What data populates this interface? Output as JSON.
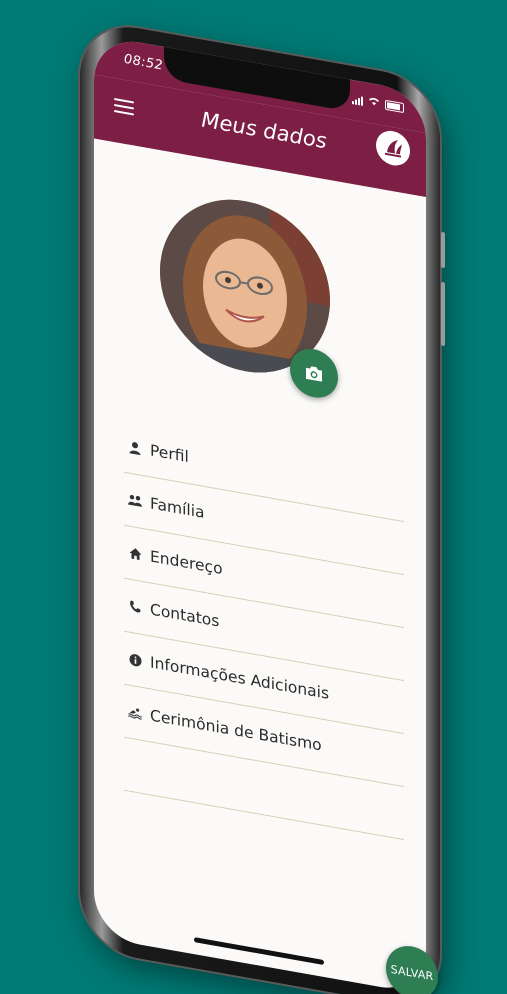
{
  "status_bar": {
    "time": "08:52"
  },
  "app_bar": {
    "title": "Meus dados",
    "menu_icon": "hamburger-menu-icon",
    "logo_icon": "church-logo-icon"
  },
  "profile": {
    "camera_icon": "camera-icon"
  },
  "menu": {
    "items": [
      {
        "label": "Perfil",
        "icon": "person-icon"
      },
      {
        "label": "Família",
        "icon": "family-icon"
      },
      {
        "label": "Endereço",
        "icon": "home-icon"
      },
      {
        "label": "Contatos",
        "icon": "phone-icon"
      },
      {
        "label": "Informações Adicionais",
        "icon": "info-icon"
      },
      {
        "label": "Cerimônia de Batismo",
        "icon": "swimming-icon"
      }
    ]
  },
  "save_button": {
    "label": "SALVAR"
  },
  "colors": {
    "background": "#007a74",
    "app_bar": "#7d1f44",
    "accent_green": "#2e7d53",
    "divider": "#d8cfb5"
  }
}
